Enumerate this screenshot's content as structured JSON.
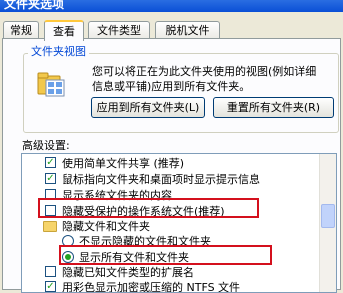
{
  "window": {
    "title": "文件夹选项"
  },
  "tabs": [
    {
      "label": "常规"
    },
    {
      "label": "查看"
    },
    {
      "label": "文件类型"
    },
    {
      "label": "脱机文件"
    }
  ],
  "folder_view": {
    "group_label": "文件夹视图",
    "description_line1": "您可以将正在为此文件夹使用的视图(例如详细",
    "description_line2": "信息或平铺)应用到所有文件夹。",
    "apply_button_label": "应用到所有文件夹(L)",
    "reset_button_label": "重置所有文件夹(R)"
  },
  "advanced": {
    "label": "高级设置:",
    "items": [
      {
        "label": "使用简单文件共享 (推荐)",
        "checked": true
      },
      {
        "label": "鼠标指向文件夹和桌面项时显示提示信息",
        "checked": true
      },
      {
        "label": "显示系统文件夹的内容",
        "checked": false
      },
      {
        "label": "隐藏受保护的操作系统文件(推荐)",
        "checked": false
      },
      {
        "label": "隐藏文件和文件夹",
        "type": "folder"
      },
      {
        "label": "不显示隐藏的文件和文件夹",
        "selected": false
      },
      {
        "label": "显示所有文件和文件夹",
        "selected": true
      },
      {
        "label": "隐藏已知文件类型的扩展名",
        "checked": false
      },
      {
        "label": "用彩色显示加密或压缩的 NTFS 文件",
        "checked": true
      }
    ]
  },
  "colors": {
    "highlight_border": "#d4101d",
    "check_mark": "#21a121",
    "group_label": "#0046d5"
  }
}
